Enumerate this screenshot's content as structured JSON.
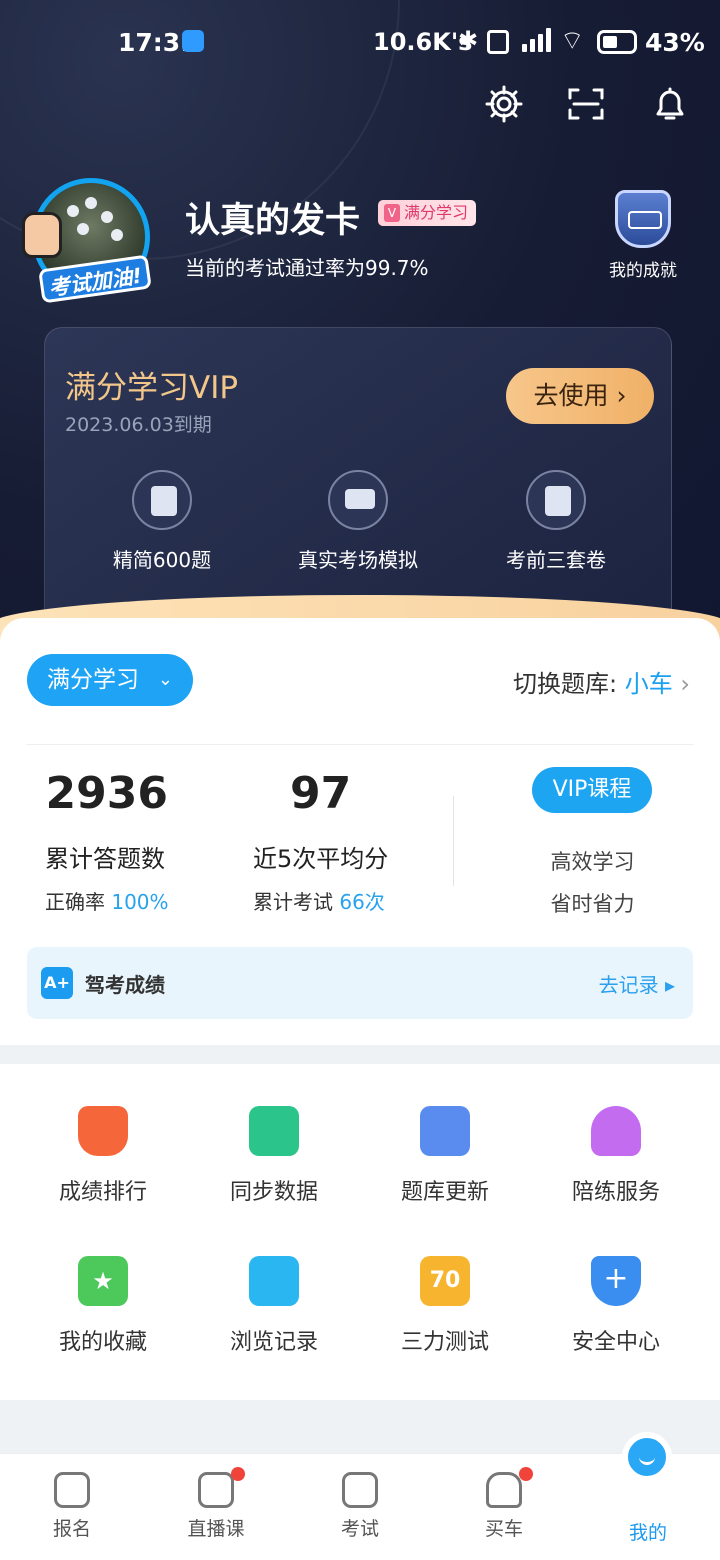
{
  "status": {
    "time": "17:31",
    "network": "10.6K's",
    "battery": "43%"
  },
  "profile": {
    "name": "认真的发卡",
    "badge": "满分学习",
    "pass_rate_text": "当前的考试通过率为99.7%",
    "achievement_label": "我的成就",
    "cheer_text": "考试加油!"
  },
  "vip": {
    "title": "满分学习VIP",
    "expire": "2023.06.03到期",
    "use_button": "去使用 ›",
    "features": [
      {
        "label": "精简600题",
        "icon": "document-icon"
      },
      {
        "label": "真实考场模拟",
        "icon": "monitor-icon"
      },
      {
        "label": "考前三套卷",
        "icon": "clipboard-icon"
      }
    ]
  },
  "study": {
    "mode": "满分学习",
    "switch_label": "切换题库: ",
    "bank": "小车",
    "stats": [
      {
        "value": "2936",
        "label": "累计答题数",
        "sub_label": "正确率 ",
        "sub_value": "100%"
      },
      {
        "value": "97",
        "label": "近5次平均分",
        "sub_label": "累计考试 ",
        "sub_value": "66次"
      }
    ],
    "vip_course": "VIP课程",
    "vip_lines": [
      "高效学习",
      "省时省力"
    ]
  },
  "record": {
    "icon_text": "A+",
    "title": "驾考成绩",
    "action": "去记录 ▸"
  },
  "grid": [
    {
      "label": "成绩排行",
      "icon": "trophy-icon",
      "color": "#f5673a"
    },
    {
      "label": "同步数据",
      "icon": "sync-icon",
      "color": "#2bc48a"
    },
    {
      "label": "题库更新",
      "icon": "refresh-doc-icon",
      "color": "#5a8cf0"
    },
    {
      "label": "陪练服务",
      "icon": "person-icon",
      "color": "#c46cf0"
    },
    {
      "label": "我的收藏",
      "icon": "star-folder-icon",
      "color": "#4cc95a"
    },
    {
      "label": "浏览记录",
      "icon": "history-icon",
      "color": "#2ab6f0"
    },
    {
      "label": "三力测试",
      "icon": "test-70-icon",
      "color": "#f7b52f",
      "icon_text": "70"
    },
    {
      "label": "安全中心",
      "icon": "shield-plus-icon",
      "color": "#3a8ef0"
    }
  ],
  "tabs": [
    {
      "label": "报名",
      "active": false
    },
    {
      "label": "直播课",
      "active": false,
      "dot": true
    },
    {
      "label": "考试",
      "active": false
    },
    {
      "label": "买车",
      "active": false,
      "dot": true
    },
    {
      "label": "我的",
      "active": true
    }
  ],
  "colors": {
    "accent": "#1fa3f5",
    "vip_gold": "#f3c78a",
    "active_tab": "#1c9af0"
  }
}
